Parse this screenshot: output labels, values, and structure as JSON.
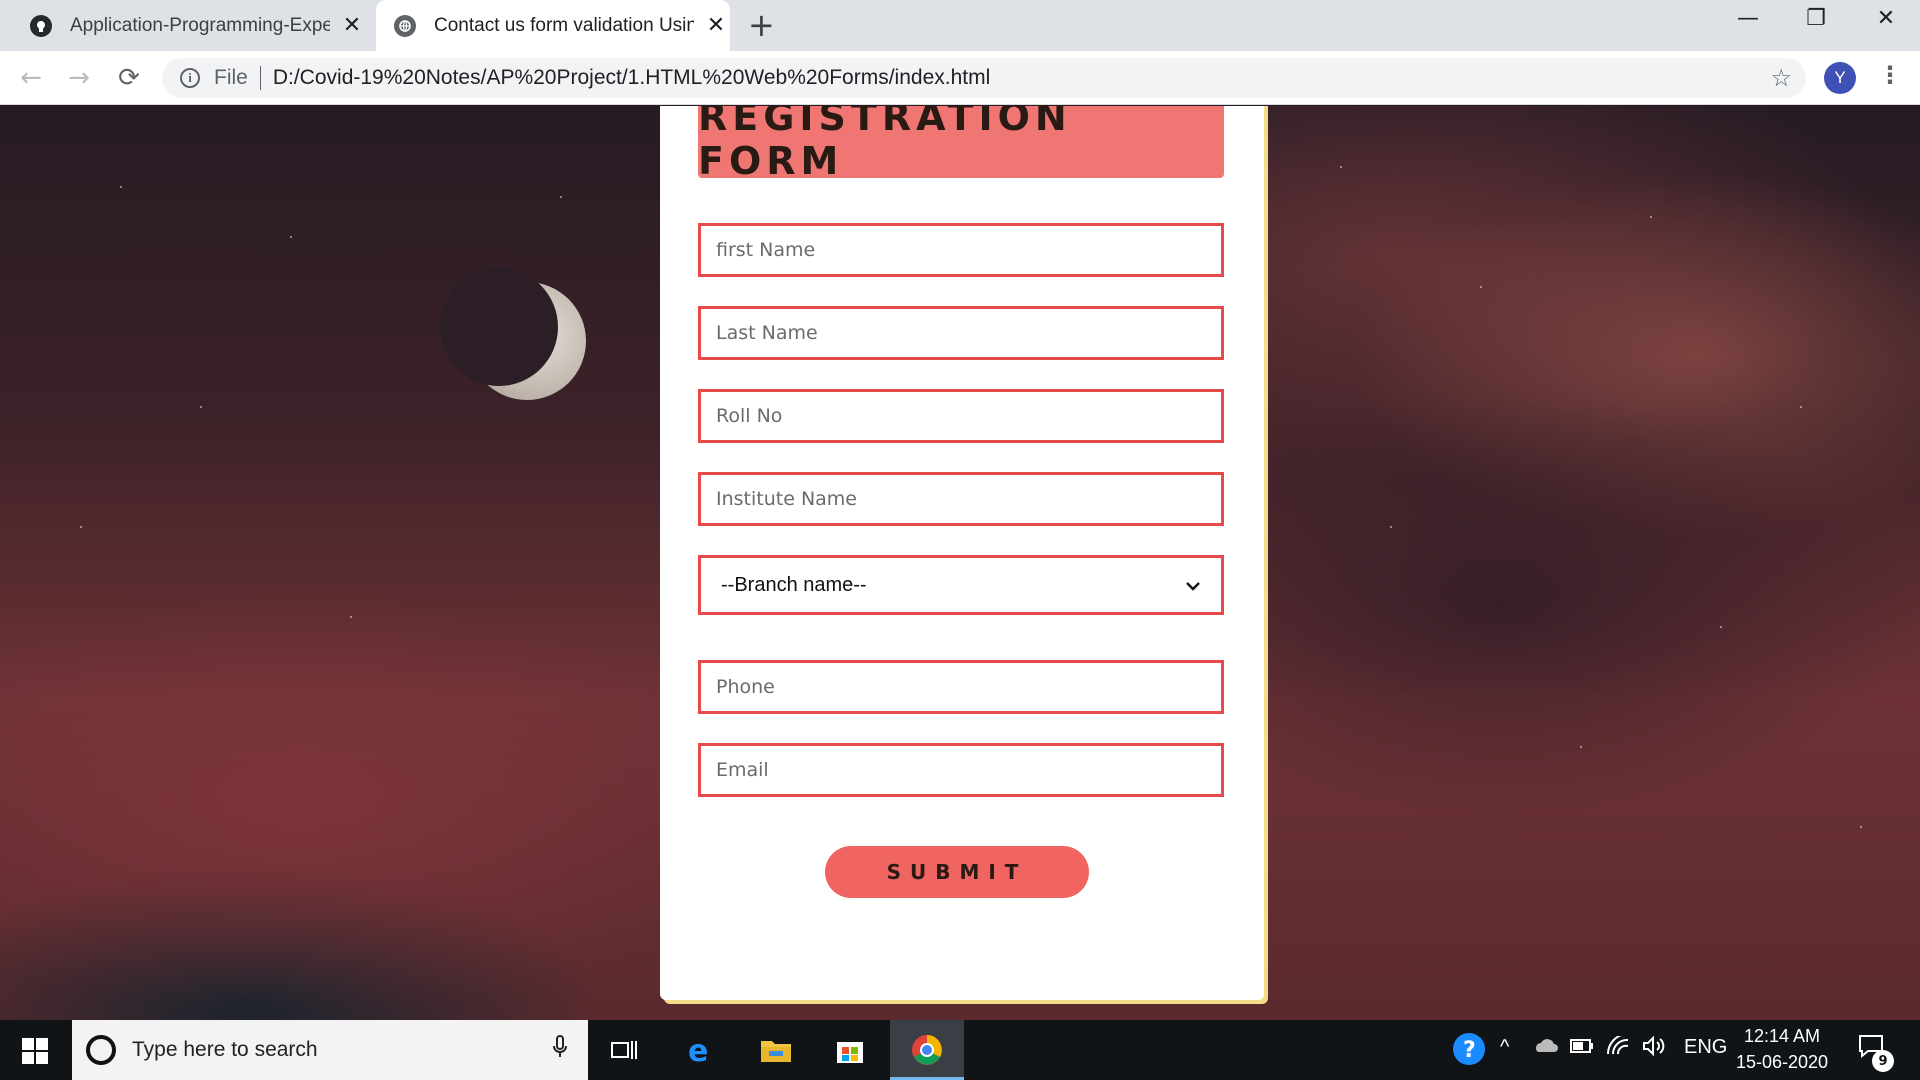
{
  "browser": {
    "tabs": [
      {
        "title": "Application-Programming-Experi",
        "close": "✕",
        "icon": "github-icon"
      },
      {
        "title": "Contact us form validation Using",
        "close": "✕",
        "icon": "globe-icon"
      }
    ],
    "new_tab": "+",
    "window_controls": {
      "minimize": "—",
      "restore": "❐",
      "close": "✕"
    },
    "toolbar": {
      "back": "←",
      "forward": "→",
      "reload": "⟳",
      "info": "i",
      "scheme_label": "File",
      "url": "D:/Covid-19%20Notes/AP%20Project/1.HTML%20Web%20Forms/index.html",
      "bookmark": "☆",
      "profile_initial": "Y",
      "menu": "⋮"
    }
  },
  "form": {
    "title": "REGISTRATION FORM",
    "fields": {
      "first_name": "first Name",
      "last_name": "Last Name",
      "roll_no": "Roll No",
      "institute": "Institute Name",
      "phone": "Phone",
      "email": "Email"
    },
    "branch_select": {
      "selected": "--Branch name--",
      "chevron": "⌄"
    },
    "submit_label": "SUBMIT"
  },
  "taskbar": {
    "search_placeholder": "Type here to search",
    "mic": "🎙",
    "help": "?",
    "tray_up": "^",
    "lang": "ENG",
    "time": "12:14 AM",
    "date": "15-06-2020",
    "notification_count": "9"
  },
  "colors": {
    "accent": "#f07674",
    "field_border": "#e84a4a",
    "card_shadow": "#f3dc8a"
  }
}
